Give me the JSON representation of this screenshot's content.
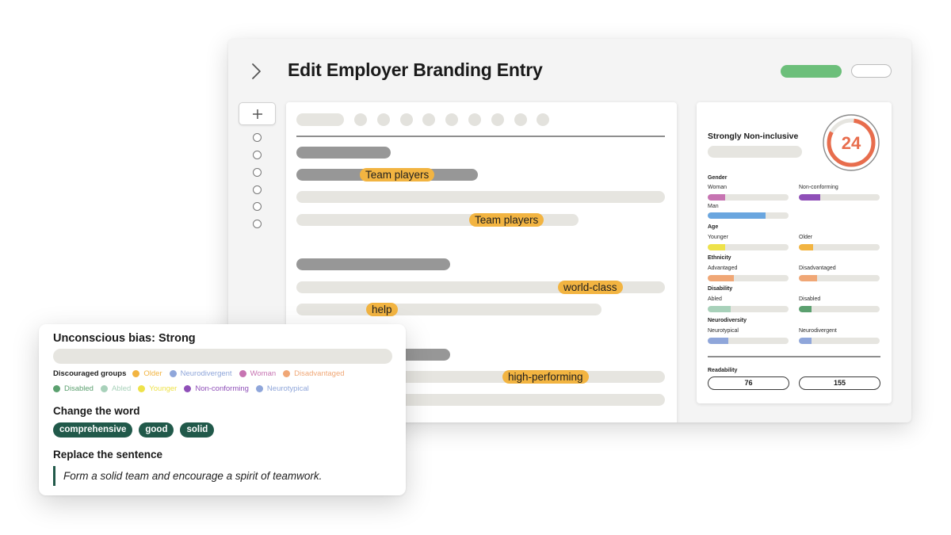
{
  "window": {
    "title": "Edit Employer Branding Entry",
    "back_icon": "chevron-right-icon",
    "add_icon": "plus-icon"
  },
  "editor": {
    "highlights": [
      "Team players",
      "Team players",
      "world-class",
      "help",
      "high-performing"
    ],
    "highlight_color": "#f2b441"
  },
  "panel": {
    "title": "Strongly Non-inclusive",
    "score": "24",
    "score_fraction": 0.24,
    "score_color": "#e86d4d",
    "categories": [
      {
        "name": "Gender",
        "items": [
          {
            "label": "Woman",
            "value": 0.22,
            "color": "#c774b2"
          },
          {
            "label": "Non-conforming",
            "value": 0.26,
            "color": "#8f4fb8"
          },
          {
            "label": "Man",
            "value": 0.72,
            "color": "#6aa6df"
          }
        ]
      },
      {
        "name": "Age",
        "items": [
          {
            "label": "Younger",
            "value": 0.22,
            "color": "#eee24a"
          },
          {
            "label": "Older",
            "value": 0.18,
            "color": "#f2b441"
          }
        ]
      },
      {
        "name": "Ethnicity",
        "items": [
          {
            "label": "Advantaged",
            "value": 0.32,
            "color": "#f0a776"
          },
          {
            "label": "Disadvantaged",
            "value": 0.23,
            "color": "#f0a776"
          }
        ]
      },
      {
        "name": "Disability",
        "items": [
          {
            "label": "Abled",
            "value": 0.28,
            "color": "#a8d1ba"
          },
          {
            "label": "Disabled",
            "value": 0.16,
            "color": "#5ba06f"
          }
        ]
      },
      {
        "name": "Neurodiversity",
        "items": [
          {
            "label": "Neurotypical",
            "value": 0.25,
            "color": "#8fa6da"
          },
          {
            "label": "Neurodivergent",
            "value": 0.16,
            "color": "#8fa6da"
          }
        ]
      }
    ],
    "readability_label": "Readability",
    "readability_values": [
      "76",
      "155"
    ]
  },
  "card": {
    "title": "Unconscious bias: Strong",
    "groups_label": "Discouraged groups",
    "groups_row1": [
      {
        "label": "Older",
        "color": "#f2b441"
      },
      {
        "label": "Neurodivergent",
        "color": "#8fa6da"
      },
      {
        "label": "Woman",
        "color": "#c774b2"
      },
      {
        "label": "Disadvantaged",
        "color": "#f0a776"
      }
    ],
    "groups_row2": [
      {
        "label": "Disabled",
        "color": "#5ba06f"
      },
      {
        "label": "Abled",
        "color": "#a8d1ba"
      },
      {
        "label": "Younger",
        "color": "#eee24a"
      },
      {
        "label": "Non-conforming",
        "color": "#8f4fb8"
      },
      {
        "label": "Neurotypical",
        "color": "#8fa6da"
      }
    ],
    "change_word_title": "Change the word",
    "word_suggestions": [
      "comprehensive",
      "good",
      "solid"
    ],
    "chip_color": "#21594a",
    "replace_title": "Replace the sentence",
    "replacement_sentence": "Form a solid team and encourage a spirit of teamwork."
  }
}
